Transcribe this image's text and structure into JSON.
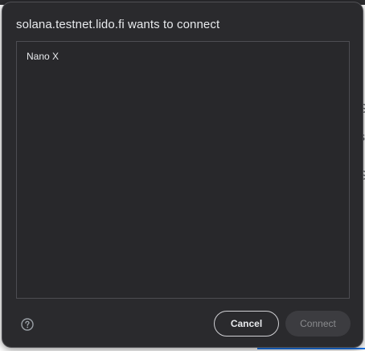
{
  "dialog": {
    "title": "solana.testnet.lido.fi wants to connect",
    "devices": [
      {
        "label": "Nano X"
      }
    ],
    "cancel_label": "Cancel",
    "connect_label": "Connect",
    "help_icon": "help-circle-icon"
  },
  "colors": {
    "dialog_bg": "#2a2a2d",
    "text": "#e8eaed",
    "border": "#4d4d52",
    "disabled_button_bg": "#3c3c40",
    "disabled_text": "#8a8b8e",
    "accent": "#1a73e8"
  }
}
